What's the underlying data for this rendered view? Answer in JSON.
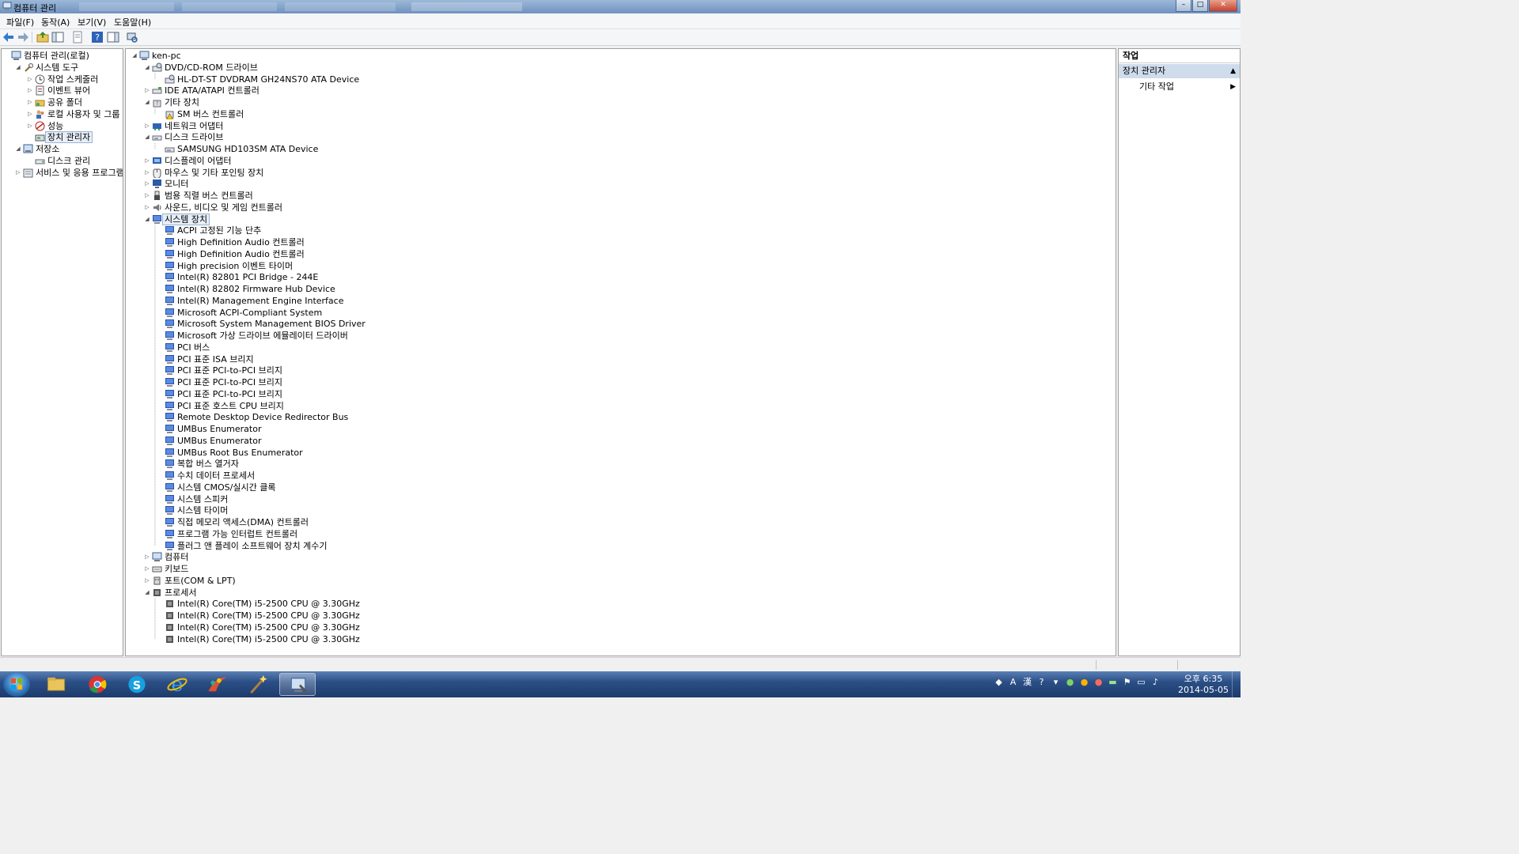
{
  "window": {
    "title": "컴퓨터 관리"
  },
  "menu": [
    "파일(F)",
    "동작(A)",
    "보기(V)",
    "도움말(H)"
  ],
  "left_tree": [
    {
      "label": "컴퓨터 관리(로컬)",
      "level": 0,
      "expander": "",
      "icon": "computer-management-icon"
    },
    {
      "label": "시스템 도구",
      "level": 1,
      "expander": "expanded",
      "icon": "system-tools-icon"
    },
    {
      "label": "작업 스케줄러",
      "level": 2,
      "expander": "collapsed",
      "icon": "task-scheduler-icon"
    },
    {
      "label": "이벤트 뷰어",
      "level": 2,
      "expander": "collapsed",
      "icon": "event-viewer-icon"
    },
    {
      "label": "공유 폴더",
      "level": 2,
      "expander": "collapsed",
      "icon": "shared-folders-icon"
    },
    {
      "label": "로컬 사용자 및 그룹",
      "level": 2,
      "expander": "collapsed",
      "icon": "local-users-icon"
    },
    {
      "label": "성능",
      "level": 2,
      "expander": "collapsed",
      "icon": "performance-icon"
    },
    {
      "label": "장치 관리자",
      "level": 2,
      "expander": "",
      "icon": "device-manager-icon",
      "selected": true
    },
    {
      "label": "저장소",
      "level": 1,
      "expander": "expanded",
      "icon": "storage-icon"
    },
    {
      "label": "디스크 관리",
      "level": 2,
      "expander": "",
      "icon": "disk-management-icon"
    },
    {
      "label": "서비스 및 응용 프로그램",
      "level": 1,
      "expander": "collapsed",
      "icon": "services-icon"
    }
  ],
  "device_tree": [
    {
      "label": "ken-pc",
      "level": 0,
      "expander": "expanded",
      "icon": "computer-icon"
    },
    {
      "label": "DVD/CD-ROM 드라이브",
      "level": 1,
      "expander": "expanded",
      "icon": "dvd-drive-icon"
    },
    {
      "label": "HL-DT-ST DVDRAM GH24NS70 ATA Device",
      "level": 2,
      "expander": "",
      "icon": "dvd-drive-icon"
    },
    {
      "label": "IDE ATA/ATAPI 컨트롤러",
      "level": 1,
      "expander": "collapsed",
      "icon": "ide-controller-icon"
    },
    {
      "label": "기타 장치",
      "level": 1,
      "expander": "expanded",
      "icon": "unknown-device-icon"
    },
    {
      "label": "SM 버스 컨트롤러",
      "level": 2,
      "expander": "",
      "icon": "unknown-device-warning-icon"
    },
    {
      "label": "네트워크 어댑터",
      "level": 1,
      "expander": "collapsed",
      "icon": "network-adapter-icon"
    },
    {
      "label": "디스크 드라이브",
      "level": 1,
      "expander": "expanded",
      "icon": "disk-drive-icon"
    },
    {
      "label": "SAMSUNG HD103SM ATA Device",
      "level": 2,
      "expander": "",
      "icon": "disk-drive-icon"
    },
    {
      "label": "디스플레이 어댑터",
      "level": 1,
      "expander": "collapsed",
      "icon": "display-adapter-icon"
    },
    {
      "label": "마우스 및 기타 포인팅 장치",
      "level": 1,
      "expander": "collapsed",
      "icon": "mouse-icon"
    },
    {
      "label": "모니터",
      "level": 1,
      "expander": "collapsed",
      "icon": "monitor-icon"
    },
    {
      "label": "범용 직렬 버스 컨트롤러",
      "level": 1,
      "expander": "collapsed",
      "icon": "usb-icon"
    },
    {
      "label": "사운드, 비디오 및 게임 컨트롤러",
      "level": 1,
      "expander": "collapsed",
      "icon": "sound-icon"
    },
    {
      "label": "시스템 장치",
      "level": 1,
      "expander": "expanded",
      "icon": "system-device-icon",
      "selected": true
    },
    {
      "label": "ACPI 고정된 기능 단추",
      "level": 2,
      "expander": "",
      "icon": "system-device-icon"
    },
    {
      "label": "High Definition Audio 컨트롤러",
      "level": 2,
      "expander": "",
      "icon": "system-device-icon"
    },
    {
      "label": "High Definition Audio 컨트롤러",
      "level": 2,
      "expander": "",
      "icon": "system-device-icon"
    },
    {
      "label": "High precision 이벤트 타이머",
      "level": 2,
      "expander": "",
      "icon": "system-device-icon"
    },
    {
      "label": "Intel(R) 82801 PCI Bridge - 244E",
      "level": 2,
      "expander": "",
      "icon": "system-device-icon"
    },
    {
      "label": "Intel(R) 82802 Firmware Hub Device",
      "level": 2,
      "expander": "",
      "icon": "system-device-icon"
    },
    {
      "label": "Intel(R) Management Engine Interface",
      "level": 2,
      "expander": "",
      "icon": "system-device-icon"
    },
    {
      "label": "Microsoft ACPI-Compliant System",
      "level": 2,
      "expander": "",
      "icon": "system-device-icon"
    },
    {
      "label": "Microsoft System Management BIOS Driver",
      "level": 2,
      "expander": "",
      "icon": "system-device-icon"
    },
    {
      "label": "Microsoft 가상 드라이브 에뮬레이터 드라이버",
      "level": 2,
      "expander": "",
      "icon": "system-device-icon"
    },
    {
      "label": "PCI 버스",
      "level": 2,
      "expander": "",
      "icon": "system-device-icon"
    },
    {
      "label": "PCI 표준 ISA 브리지",
      "level": 2,
      "expander": "",
      "icon": "system-device-icon"
    },
    {
      "label": "PCI 표준 PCI-to-PCI 브리지",
      "level": 2,
      "expander": "",
      "icon": "system-device-icon"
    },
    {
      "label": "PCI 표준 PCI-to-PCI 브리지",
      "level": 2,
      "expander": "",
      "icon": "system-device-icon"
    },
    {
      "label": "PCI 표준 PCI-to-PCI 브리지",
      "level": 2,
      "expander": "",
      "icon": "system-device-icon"
    },
    {
      "label": "PCI 표준 호스트 CPU 브리지",
      "level": 2,
      "expander": "",
      "icon": "system-device-icon"
    },
    {
      "label": "Remote Desktop Device Redirector Bus",
      "level": 2,
      "expander": "",
      "icon": "system-device-icon"
    },
    {
      "label": "UMBus Enumerator",
      "level": 2,
      "expander": "",
      "icon": "system-device-icon"
    },
    {
      "label": "UMBus Enumerator",
      "level": 2,
      "expander": "",
      "icon": "system-device-icon"
    },
    {
      "label": "UMBus Root Bus Enumerator",
      "level": 2,
      "expander": "",
      "icon": "system-device-icon"
    },
    {
      "label": "복합 버스 열거자",
      "level": 2,
      "expander": "",
      "icon": "system-device-icon"
    },
    {
      "label": "수치 데이터 프로세서",
      "level": 2,
      "expander": "",
      "icon": "system-device-icon"
    },
    {
      "label": "시스템 CMOS/실시간 클록",
      "level": 2,
      "expander": "",
      "icon": "system-device-icon"
    },
    {
      "label": "시스템 스피커",
      "level": 2,
      "expander": "",
      "icon": "system-device-icon"
    },
    {
      "label": "시스템 타이머",
      "level": 2,
      "expander": "",
      "icon": "system-device-icon"
    },
    {
      "label": "직접 메모리 액세스(DMA) 컨트롤러",
      "level": 2,
      "expander": "",
      "icon": "system-device-icon"
    },
    {
      "label": "프로그램 가능 인터럽트 컨트롤러",
      "level": 2,
      "expander": "",
      "icon": "system-device-icon"
    },
    {
      "label": "플러그 앤 플레이 소프트웨어 장치 계수기",
      "level": 2,
      "expander": "",
      "icon": "system-device-icon"
    },
    {
      "label": "컴퓨터",
      "level": 1,
      "expander": "collapsed",
      "icon": "computer-icon"
    },
    {
      "label": "키보드",
      "level": 1,
      "expander": "collapsed",
      "icon": "keyboard-icon"
    },
    {
      "label": "포트(COM & LPT)",
      "level": 1,
      "expander": "collapsed",
      "icon": "port-icon"
    },
    {
      "label": "프로세서",
      "level": 1,
      "expander": "expanded",
      "icon": "processor-icon"
    },
    {
      "label": "Intel(R) Core(TM) i5-2500 CPU @ 3.30GHz",
      "level": 2,
      "expander": "",
      "icon": "processor-icon"
    },
    {
      "label": "Intel(R) Core(TM) i5-2500 CPU @ 3.30GHz",
      "level": 2,
      "expander": "",
      "icon": "processor-icon"
    },
    {
      "label": "Intel(R) Core(TM) i5-2500 CPU @ 3.30GHz",
      "level": 2,
      "expander": "",
      "icon": "processor-icon"
    },
    {
      "label": "Intel(R) Core(TM) i5-2500 CPU @ 3.30GHz",
      "level": 2,
      "expander": "",
      "icon": "processor-icon"
    }
  ],
  "actions": {
    "header": "작업",
    "section": "장치 관리자",
    "item": "기타 작업"
  },
  "taskbar": {
    "apps": [
      "windows-explorer-icon",
      "chrome-icon",
      "skype-icon",
      "internet-explorer-icon",
      "paint-icon",
      "magic-wand-icon",
      "computer-management-icon"
    ],
    "tray_ime": "A",
    "tray_hanja": "漢",
    "clock_time": "오후 6:35",
    "clock_date": "2014-05-05"
  }
}
